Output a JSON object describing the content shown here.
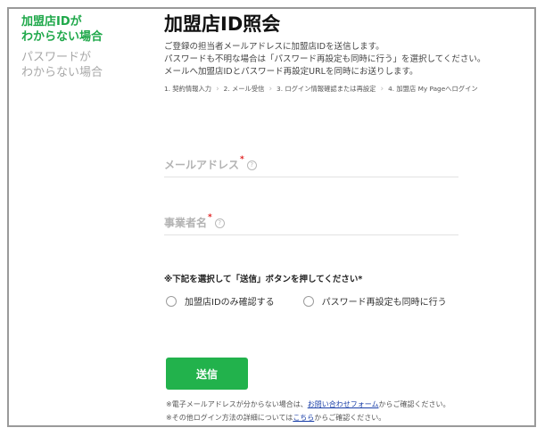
{
  "sidebar": {
    "items": [
      {
        "line1": "加盟店IDが",
        "line2": "わからない場合",
        "active": true
      },
      {
        "line1": "パスワードが",
        "line2": "わからない場合",
        "active": false
      }
    ]
  },
  "main": {
    "title": "加盟店ID照会",
    "description": [
      "ご登録の担当者メールアドレスに加盟店IDを送信します。",
      "パスワードも不明な場合は「パスワード再設定も同時に行う」を選択してください。",
      "メールへ加盟店IDとパスワード再設定URLを同時にお送りします。"
    ],
    "steps": [
      "1. 契約情報入力",
      "2. メール受信",
      "3. ログイン情報確認または再設定",
      "4. 加盟店 My Pageへログイン"
    ]
  },
  "form": {
    "email_label": "メールアドレス",
    "business_label": "事業者名",
    "required_mark": "*",
    "help_glyph": "?",
    "instruction": "※下記を選択して「送信」ボタンを押してください*",
    "options": [
      "加盟店IDのみ確認する",
      "パスワード再設定も同時に行う"
    ],
    "submit_label": "送信"
  },
  "notes": {
    "note1_prefix": "※電子メールアドレスが分からない場合は、",
    "note1_link": "お問い合わせフォーム",
    "note1_suffix": "からご確認ください。",
    "note2_prefix": "※その他ログイン方法の詳細については",
    "note2_link": "こちら",
    "note2_suffix": "からご確認ください。"
  },
  "colors": {
    "accent_green": "#22b24c",
    "required_red": "#e02020",
    "link_blue": "#1a3fa8"
  }
}
